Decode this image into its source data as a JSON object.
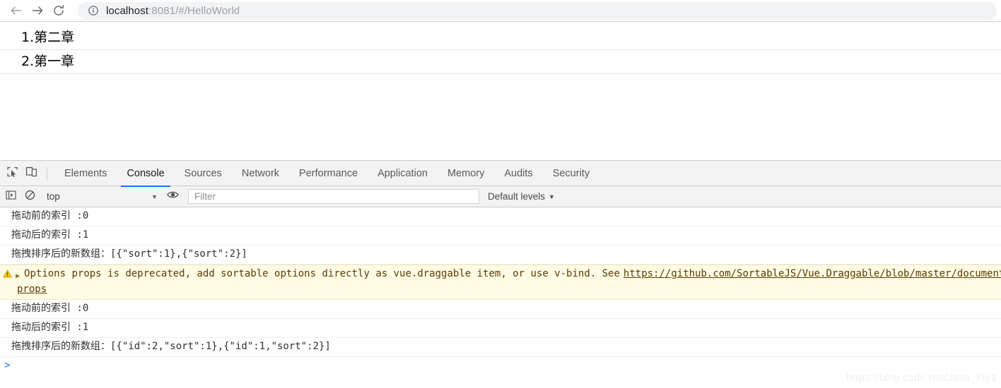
{
  "browser": {
    "back_icon": "arrow-left-icon",
    "forward_icon": "arrow-right-icon",
    "reload_icon": "reload-icon",
    "info_icon": "info-circle-icon",
    "url_host": "localhost",
    "url_rest": ":8081/#/HelloWorld",
    "url_full": "localhost:8081/#/HelloWorld"
  },
  "page": {
    "items": [
      {
        "label": "1.第二章"
      },
      {
        "label": "2.第一章"
      }
    ]
  },
  "devtools": {
    "inspect_icon": "inspect-element-icon",
    "device_icon": "device-toolbar-icon",
    "tabs": [
      {
        "label": "Elements",
        "active": false
      },
      {
        "label": "Console",
        "active": true
      },
      {
        "label": "Sources",
        "active": false
      },
      {
        "label": "Network",
        "active": false
      },
      {
        "label": "Performance",
        "active": false
      },
      {
        "label": "Application",
        "active": false
      },
      {
        "label": "Memory",
        "active": false
      },
      {
        "label": "Audits",
        "active": false
      },
      {
        "label": "Security",
        "active": false
      }
    ],
    "active_tab_color": "#1a73e8",
    "toolbar": {
      "sidebar_icon": "console-sidebar-toggle-icon",
      "clear_icon": "clear-console-icon",
      "context": "top",
      "context_caret": "▼",
      "eye_icon": "live-expression-eye-icon",
      "filter_placeholder": "Filter",
      "filter_value": "",
      "levels_label": "Default levels",
      "levels_caret": "▼"
    },
    "console": {
      "messages": [
        {
          "type": "log",
          "text": "拖动前的索引 :0"
        },
        {
          "type": "log",
          "text": "拖动后的索引 :1"
        },
        {
          "type": "log",
          "text": "拖拽排序后的新数组：[{\"sort\":1},{\"sort\":2}]"
        },
        {
          "type": "warning",
          "icon": "warning-triangle-icon",
          "disclosure": "▶",
          "text": "Options props is deprecated, add sortable options directly as vue.draggable item, or use v-bind. See ",
          "link": "https://github.com/SortableJS/Vue.Draggable/blob/master/documentati",
          "wrap_text": "props",
          "bg_color": "#fffbe5"
        },
        {
          "type": "log",
          "text": "拖动前的索引 :0"
        },
        {
          "type": "log",
          "text": "拖动后的索引 :1"
        },
        {
          "type": "log",
          "text": "拖拽排序后的新数组：[{\"id\":2,\"sort\":1},{\"id\":1,\"sort\":2}]"
        }
      ],
      "prompt_caret": ">",
      "prompt_value": ""
    }
  },
  "watermark": {
    "text": "https://blog.csdn.net/Java_Fly1"
  }
}
